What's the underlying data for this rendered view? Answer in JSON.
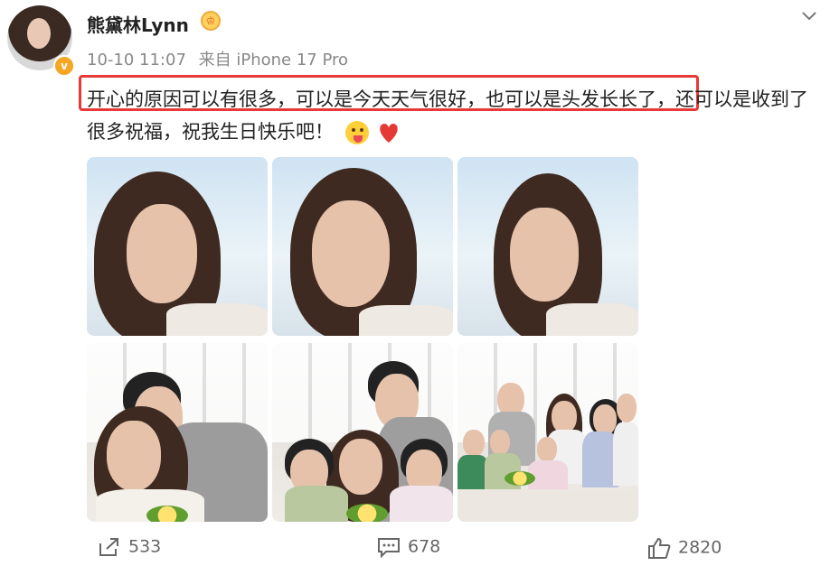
{
  "post": {
    "username": "熊黛林Lynn",
    "timestamp": "10-10 11:07",
    "source": "来自 iPhone 17 Pro",
    "text_highlighted": "开心的原因可以有很多，可以是今天天气很好，也可以是头发长长了",
    "text_rest": "，还可以是收到了很多祝福，祝我生日快乐吧！",
    "emojis": [
      "tongue-out-face-icon",
      "red-heart-icon"
    ],
    "highlight_color": "#e73935"
  },
  "actions": {
    "share_count": "533",
    "comment_count": "678",
    "like_count": "2820"
  },
  "photos": [
    {
      "label": "selfie-sky-1"
    },
    {
      "label": "selfie-sky-2"
    },
    {
      "label": "selfie-sky-3"
    },
    {
      "label": "couple-photo"
    },
    {
      "label": "family-photo-four"
    },
    {
      "label": "family-group-photo"
    }
  ]
}
